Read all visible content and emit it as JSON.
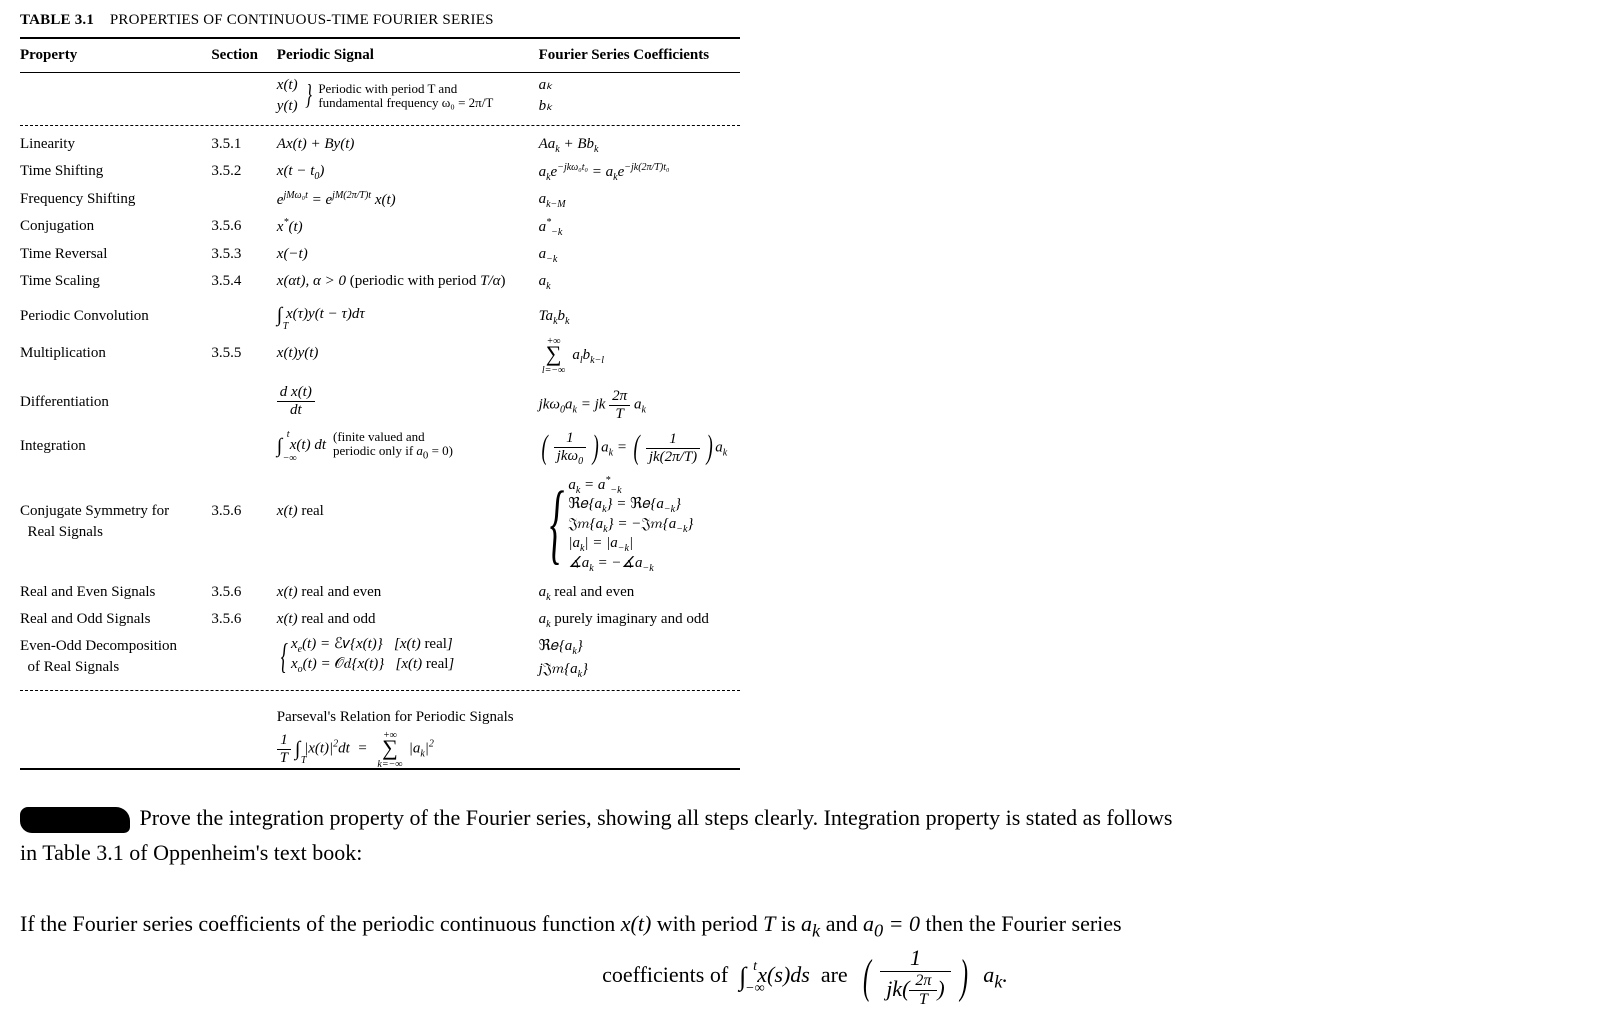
{
  "table": {
    "number": "TABLE 3.1",
    "caption": "PROPERTIES OF CONTINUOUS-TIME FOURIER SERIES",
    "headers": {
      "property": "Property",
      "section": "Section",
      "signal": "Periodic Signal",
      "coeff": "Fourier Series Coefficients"
    },
    "intro": {
      "signal_line1": "x(t)",
      "signal_line2": "y(t)",
      "signal_desc1": "Periodic with period T and",
      "signal_desc2": "fundamental frequency ω₀ = 2π/T",
      "coef_line1": "aₖ",
      "coef_line2": "bₖ"
    },
    "rows": [
      {
        "property": "Linearity",
        "section": "3.5.1",
        "signal": "Ax(t) + By(t)",
        "coeff": "Aaₖ + Bbₖ"
      },
      {
        "property": "Time Shifting",
        "section": "3.5.2",
        "signal": "x(t − t₀)",
        "coeff": "aₖe^{−jkω₀t₀} = aₖe^{−jk(2π/T)t₀}"
      },
      {
        "property": "Frequency Shifting",
        "section": "",
        "signal": "e^{jMω₀t} = e^{jM(2π/T)t} x(t)",
        "coeff": "a_{k−M}"
      },
      {
        "property": "Conjugation",
        "section": "3.5.6",
        "signal": "x*(t)",
        "coeff": "a*_{−k}"
      },
      {
        "property": "Time Reversal",
        "section": "3.5.3",
        "signal": "x(−t)",
        "coeff": "a_{−k}"
      },
      {
        "property": "Time Scaling",
        "section": "3.5.4",
        "signal": "x(αt), α > 0 (periodic with period T/α)",
        "coeff": "aₖ"
      },
      {
        "property": "Periodic Convolution",
        "section": "",
        "signal": "∫_T x(τ)y(t − τ)dτ",
        "coeff": "Taₖbₖ"
      },
      {
        "property": "Multiplication",
        "section": "3.5.5",
        "signal": "x(t)y(t)",
        "coeff": "Σ_{l=−∞}^{+∞} aₗ b_{k−l}"
      },
      {
        "property": "Differentiation",
        "section": "",
        "signal": "dx(t)/dt",
        "coeff": "jkω₀aₖ = jk(2π/T)aₖ"
      },
      {
        "property": "Integration",
        "section": "",
        "signal": "∫_{−∞}^{t} x(t) dt  (finite valued and periodic only if a₀ = 0)",
        "coeff": "(1/(jkω₀))aₖ = (1/(jk(2π/T)))aₖ"
      },
      {
        "property": "Conjugate Symmetry for Real Signals",
        "section": "3.5.6",
        "signal": "x(t) real",
        "coeff": "aₖ = a*_{−k};  ℜe{aₖ} = ℜe{a_{−k}};  𝔍m{aₖ} = −𝔍m{a_{−k}};  |aₖ| = |a_{−k}|;  ∡aₖ = −∡a_{−k}"
      },
      {
        "property": "Real and Even Signals",
        "section": "3.5.6",
        "signal": "x(t) real and even",
        "coeff": "aₖ real and even"
      },
      {
        "property": "Real and Odd Signals",
        "section": "3.5.6",
        "signal": "x(t) real and odd",
        "coeff": "aₖ purely imaginary and odd"
      },
      {
        "property": "Even-Odd Decomposition of Real Signals",
        "section": "",
        "signal": "xₑ(t) = ℰv{x(t)}  [x(t) real];  xₒ(t) = 𝒪d{x(t)}  [x(t) real]",
        "coeff": "ℜe{aₖ};  j𝔍m{aₖ}"
      }
    ],
    "parseval": {
      "title": "Parseval's Relation for Periodic Signals",
      "equation": "(1/T) ∫_T |x(t)|² dt = Σ_{k=−∞}^{+∞} |aₖ|²"
    }
  },
  "problem": {
    "line1a": "Prove the integration property of the Fourier series, showing all steps clearly. Integration property is stated as follows",
    "line1b": "in Table 3.1 of Oppenheim's text book:",
    "line2": "If the Fourier series coefficients of the periodic continuous function x(t) with period T is aₖ and a₀ = 0 then the Fourier series",
    "line3_left": "coefficients of ∫_{−∞}^{t} x(s)ds are",
    "line3_right": "(1 / (jk(2π/T))) aₖ."
  }
}
